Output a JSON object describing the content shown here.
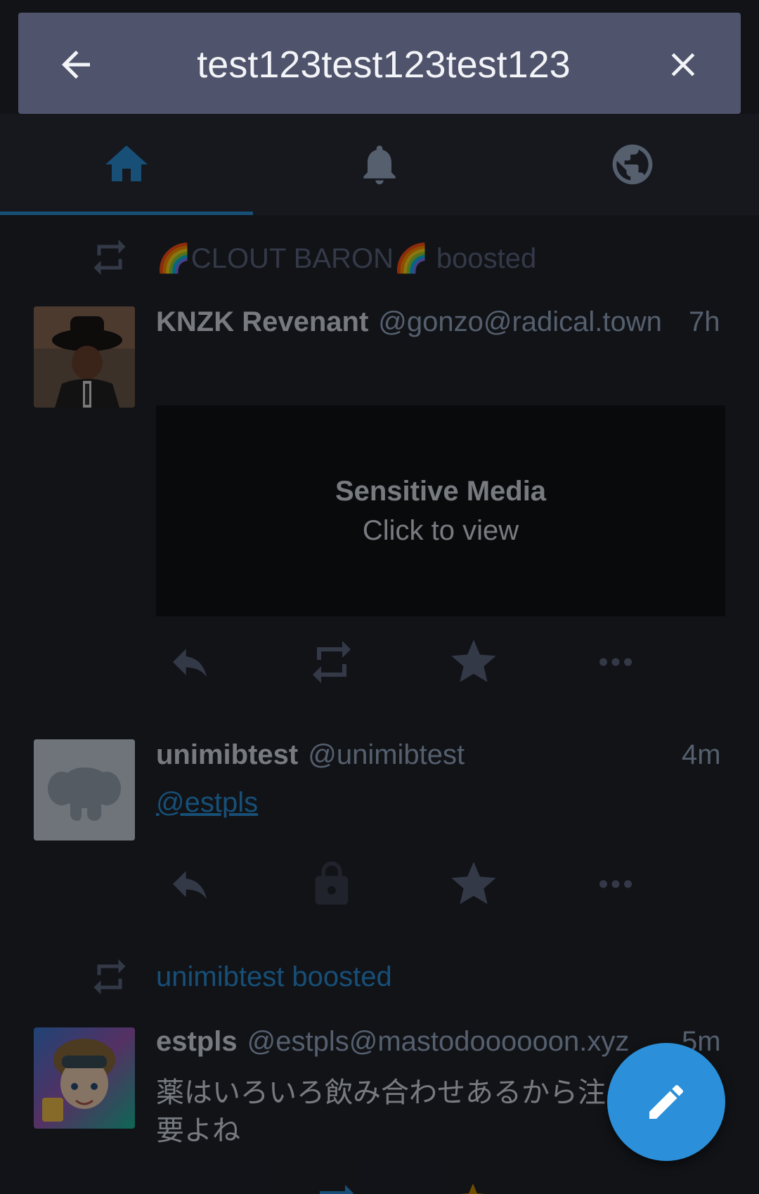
{
  "search": {
    "query": "test123test123test123"
  },
  "tabs": [
    {
      "name": "home",
      "icon": "home-icon",
      "active": true
    },
    {
      "name": "notifications",
      "icon": "bell-icon",
      "active": false
    },
    {
      "name": "federated",
      "icon": "globe-icon",
      "active": false
    }
  ],
  "statuses": [
    {
      "boost_label": "🌈CLOUT BARON🌈 boosted",
      "display_name": "KNZK Revenant",
      "handle": "@gonzo@radical.town",
      "time": "7h",
      "sensitive_title": "Sensitive Media",
      "sensitive_sub": "Click to view"
    },
    {
      "display_name": "unimibtest",
      "handle": "@unimibtest",
      "time": "4m",
      "content_mention": "@estpls"
    },
    {
      "boost_label": "unimibtest boosted",
      "display_name": "estpls",
      "handle": "@estpls@mastodoooooon.xyz",
      "time": "5m",
      "content_line1": "薬はいろいろ飲み合わせあるから注",
      "content_line2": "要よね"
    }
  ],
  "colors": {
    "accent": "#2b90d9",
    "searchbar": "#7d83a8",
    "background": "#1f232b"
  }
}
